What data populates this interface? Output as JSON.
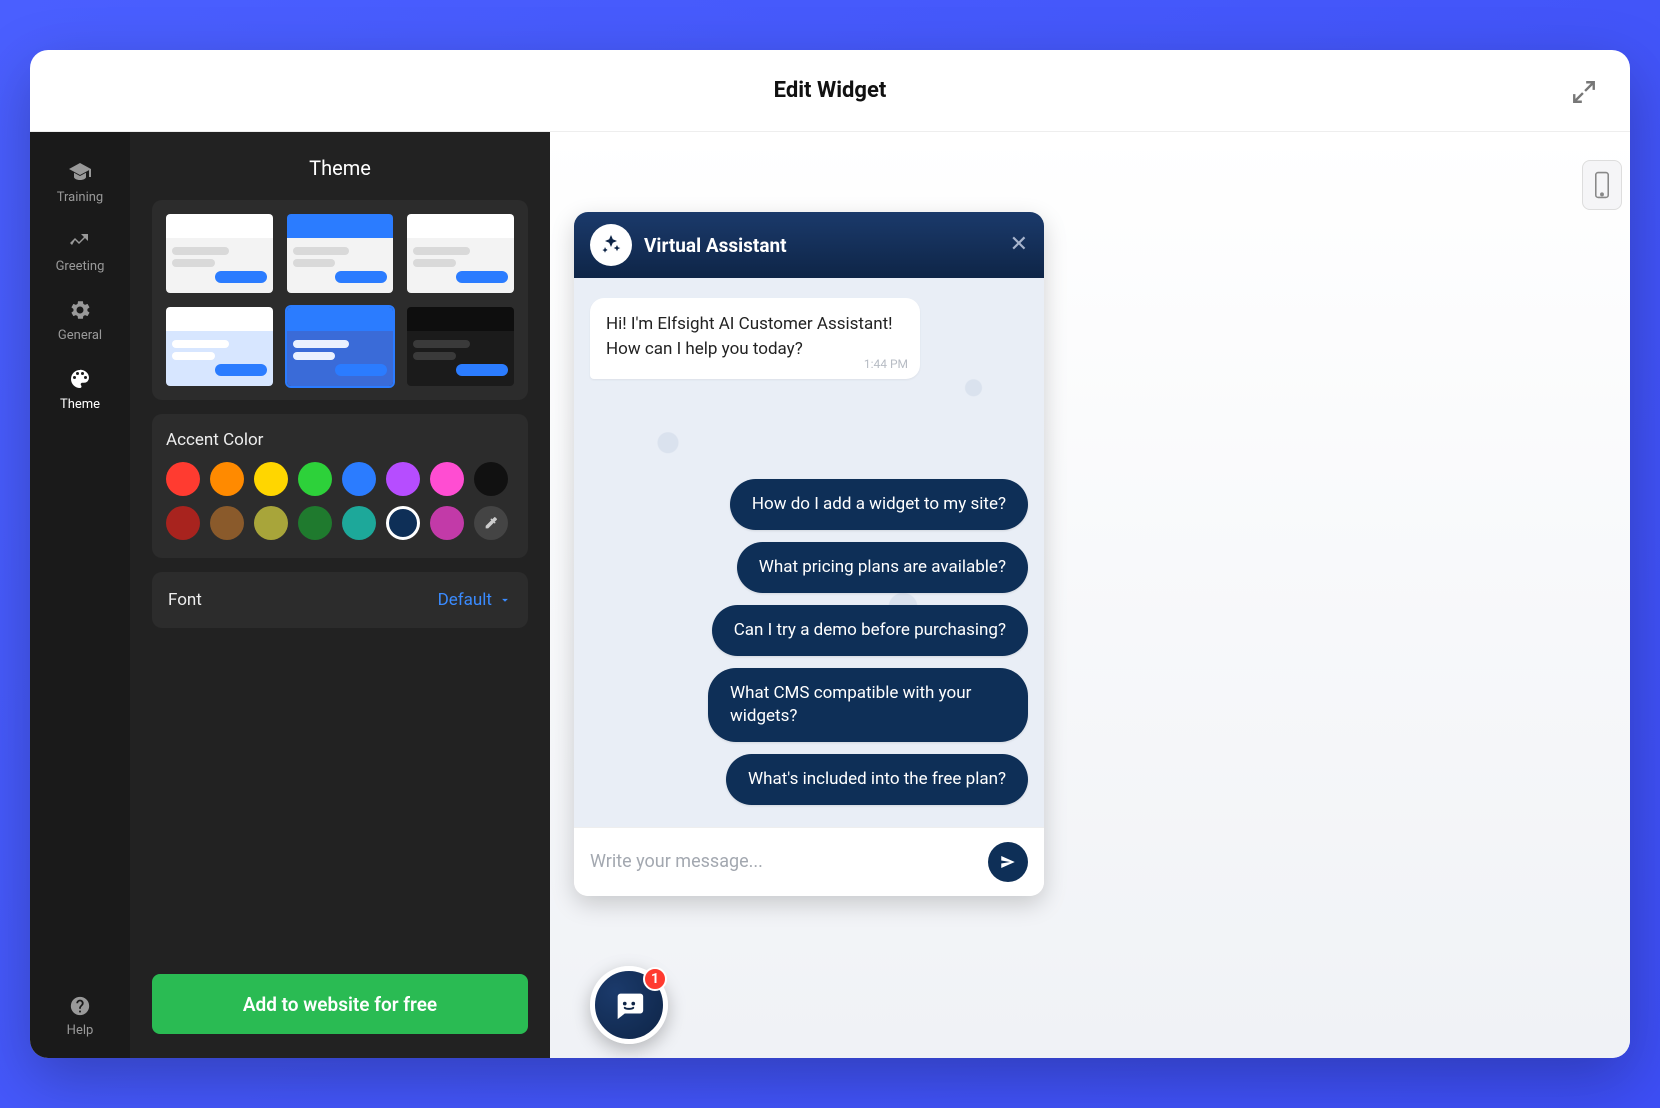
{
  "header": {
    "title": "Edit Widget"
  },
  "nav": {
    "items": [
      {
        "label": "Training",
        "icon": "graduation-cap-icon"
      },
      {
        "label": "Greeting",
        "icon": "wave-icon"
      },
      {
        "label": "General",
        "icon": "gear-icon"
      },
      {
        "label": "Theme",
        "icon": "palette-icon"
      }
    ],
    "active_index": 3,
    "help_label": "Help"
  },
  "theme_panel": {
    "title": "Theme",
    "selected_theme_index": 4,
    "themes": [
      {
        "header": "#ffffff",
        "body": "#f3f3f3",
        "left": "#d9d9d9",
        "right": "#2b7cff"
      },
      {
        "header": "#2b7cff",
        "body": "#f3f3f3",
        "left": "#d9d9d9",
        "right": "#2b7cff"
      },
      {
        "header": "#ffffff",
        "body": "#f3f3f3",
        "left": "#d9d9d9",
        "right": "#2b7cff"
      },
      {
        "header": "#ffffff",
        "body": "#d7e6ff",
        "left": "#ffffff",
        "right": "#2b7cff"
      },
      {
        "header": "#2b7cff",
        "body": "#3a6bd8",
        "left": "#eaf1ff",
        "right": "#2b7cff"
      },
      {
        "header": "#0e0e0e",
        "body": "#1b1b1b",
        "left": "#3a3a3a",
        "right": "#2b7cff"
      }
    ],
    "accent_label": "Accent Color",
    "accent_colors_row1": [
      "#ff3b30",
      "#ff8a00",
      "#ffd600",
      "#2dd13a",
      "#2b7cff",
      "#b64dff",
      "#ff4dd2",
      "#111111"
    ],
    "accent_colors_row2": [
      "#a8231e",
      "#8a5a2b",
      "#a8a53a",
      "#1f7a2e",
      "#1da89a",
      "#0e2f57",
      "#c23aa8"
    ],
    "selected_accent": "#0e2f57",
    "font_label": "Font",
    "font_value": "Default",
    "cta_label": "Add to website for free"
  },
  "chat": {
    "title": "Virtual Assistant",
    "greeting": "Hi! I'm Elfsight AI Customer Assistant! How can I help you today?",
    "greeting_time": "1:44 PM",
    "suggestions": [
      "How do I add a widget to my site?",
      "What pricing plans are available?",
      "Can I try a demo before purchasing?",
      "What CMS compatible with your widgets?",
      "What's included into the free plan?"
    ],
    "input_placeholder": "Write your message...",
    "badge_count": "1"
  }
}
